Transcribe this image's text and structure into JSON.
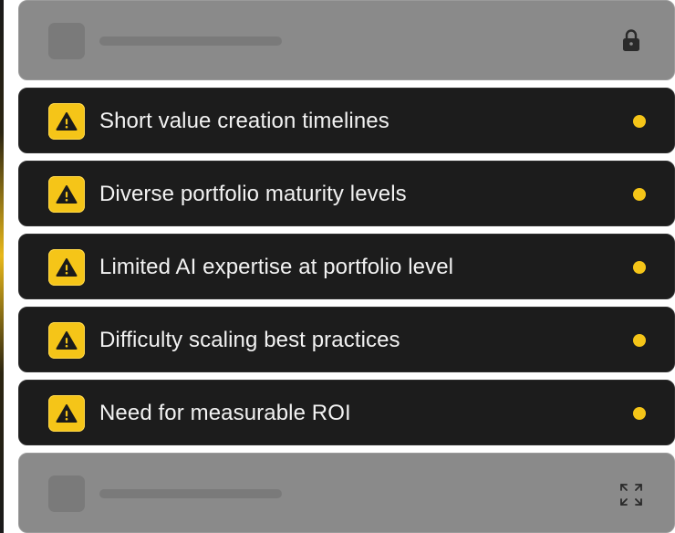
{
  "colors": {
    "card_background": "#1c1c1c",
    "placeholder_background": "#8a8a8a",
    "accent": "#f5c518",
    "text": "#f2f2f2"
  },
  "placeholder_top": {
    "icon": "lock-icon"
  },
  "placeholder_bottom": {
    "icon": "expand-icon"
  },
  "risks": [
    {
      "label": "Short value creation timelines",
      "icon": "warning-icon",
      "status_color": "#f5c518"
    },
    {
      "label": "Diverse portfolio maturity levels",
      "icon": "warning-icon",
      "status_color": "#f5c518"
    },
    {
      "label": "Limited AI expertise at portfolio level",
      "icon": "warning-icon",
      "status_color": "#f5c518"
    },
    {
      "label": "Difficulty scaling best practices",
      "icon": "warning-icon",
      "status_color": "#f5c518"
    },
    {
      "label": "Need for measurable ROI",
      "icon": "warning-icon",
      "status_color": "#f5c518"
    }
  ]
}
